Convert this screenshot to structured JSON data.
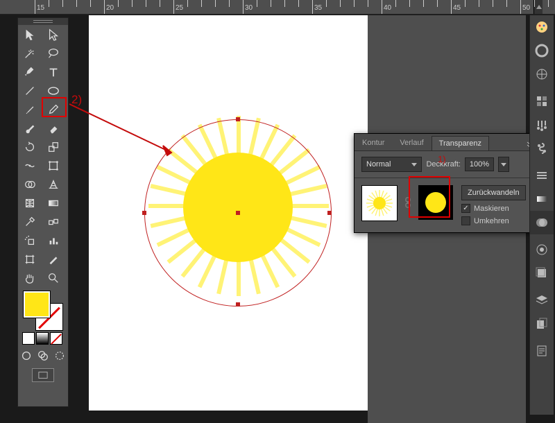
{
  "ruler": {
    "marks": [
      15,
      20,
      25,
      30,
      35,
      40,
      45,
      50
    ]
  },
  "annotation": {
    "tool_label": "2)"
  },
  "transparency_panel": {
    "tabs": [
      "Kontur",
      "Verlauf",
      "Transparenz"
    ],
    "active_tab": 2,
    "blend_mode": "Normal",
    "opacity_label": "Deckkraft:",
    "opacity_value": "100%",
    "convert_button": "Zurückwandeln",
    "mask_checkbox": "Maskieren",
    "mask_checked": true,
    "invert_checkbox": "Umkehren",
    "invert_checked": false,
    "mask_annotation": "1)"
  },
  "toolbox_colors": {
    "fill": "#ffe617"
  },
  "right_dock": {
    "icons": [
      "color-wheel",
      "color-ring",
      "guide",
      "swatches",
      "brushes",
      "symbols",
      "sep",
      "stroke",
      "gradient",
      "transparency",
      "sep",
      "appearance",
      "graphic-styles",
      "sep",
      "layers",
      "artboards",
      "sep",
      "text"
    ]
  }
}
